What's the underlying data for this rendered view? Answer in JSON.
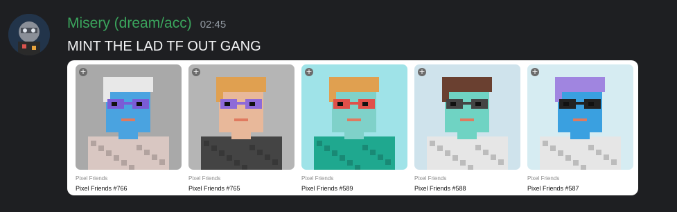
{
  "message": {
    "username": "Misery (dream/acc)",
    "timestamp": "02:45",
    "text": "MINT THE LAD TF OUT GANG",
    "username_color": "#3ba55d"
  },
  "embed": {
    "cards": [
      {
        "collection": "Pixel Friends",
        "name": "Pixel Friends #766",
        "bg": "#a9a9a9",
        "skin": "#4aa3e0",
        "hair": "#e8e8e8",
        "glasses": "#7a5cd6",
        "shirt": "#d9c7c2"
      },
      {
        "collection": "Pixel Friends",
        "name": "Pixel Friends #765",
        "bg": "#b5b5b5",
        "skin": "#e8b89a",
        "hair": "#e0a050",
        "glasses": "#8e6ad8",
        "shirt": "#444444"
      },
      {
        "collection": "Pixel Friends",
        "name": "Pixel Friends #589",
        "bg": "#9fe3e8",
        "skin": "#7fd1c9",
        "hair": "#e0a050",
        "glasses": "#e0504a",
        "shirt": "#1fa88f"
      },
      {
        "collection": "Pixel Friends",
        "name": "Pixel Friends #588",
        "bg": "#cfe3ec",
        "skin": "#6fd3c3",
        "hair": "#6a4030",
        "glasses": "#444444",
        "shirt": "#e6e6e6"
      },
      {
        "collection": "Pixel Friends",
        "name": "Pixel Friends #587",
        "bg": "#d6ecf2",
        "skin": "#3aa0e0",
        "hair": "#a085e0",
        "glasses": "#222222",
        "shirt": "#e6e6e6"
      }
    ],
    "add_icon": "plus-icon",
    "add_symbol": "+"
  }
}
